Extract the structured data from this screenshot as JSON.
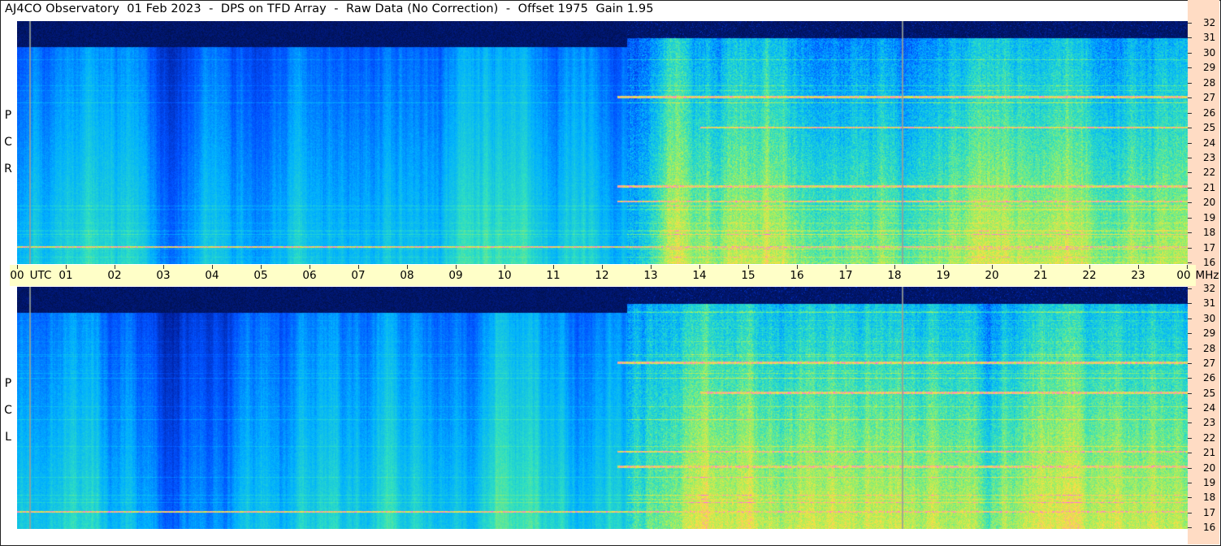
{
  "title": "AJ4CO Observatory  01 Feb 2023  -  DPS on TFD Array  -  Raw Data (No Correction)  -  Offset 1975  Gain 1.95",
  "top_label": [
    "R",
    "C",
    "P"
  ],
  "bottom_label": [
    "L",
    "C",
    "P"
  ],
  "time_axis": {
    "labels": [
      "00",
      "01",
      "02",
      "03",
      "04",
      "05",
      "06",
      "07",
      "08",
      "09",
      "10",
      "11",
      "12",
      "13",
      "14",
      "15",
      "16",
      "17",
      "18",
      "19",
      "20",
      "21",
      "22",
      "23",
      "00"
    ],
    "unit": "UTC",
    "freq_unit": "MHz"
  },
  "freq_axis": {
    "labels": [
      "32",
      "31",
      "30",
      "29",
      "28",
      "27",
      "26",
      "25",
      "24",
      "23",
      "22",
      "21",
      "20",
      "19",
      "18",
      "17",
      "16"
    ]
  },
  "chart_data": {
    "type": "heatmap",
    "title": "AJ4CO Observatory  01 Feb 2023  -  DPS on TFD Array  -  Raw Data (No Correction)  -  Offset 1975  Gain 1.95",
    "x_range": [
      0,
      24
    ],
    "x_unit": "UTC",
    "y_range": [
      16,
      32
    ],
    "y_unit": "MHz",
    "panels": [
      "RCP",
      "LCP"
    ],
    "colormap": [
      "#000820",
      "#0020a0",
      "#0050ff",
      "#00b0ff",
      "#30e0c0",
      "#a0f060",
      "#ffe040",
      "#ff60ff"
    ],
    "noise_onset_utc": 12.5,
    "marker_lines_utc": [
      0.25,
      18.15
    ],
    "persistent_interference_mhz": [
      17.1,
      20.1,
      21.1,
      25.0,
      27.0
    ]
  }
}
